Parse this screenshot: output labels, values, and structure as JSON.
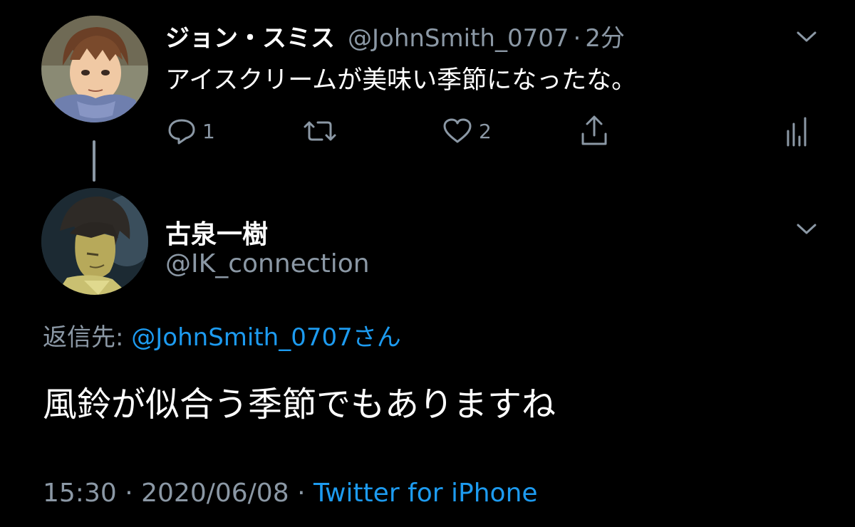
{
  "parent_tweet": {
    "display_name": "ジョン・スミス",
    "handle": "@JohnSmith_0707",
    "separator": "·",
    "time_ago": "2分",
    "text": "アイスクリームが美味い季節になったな。",
    "reply_count": "1",
    "like_count": "2",
    "avatar_icon": "avatar-john-smith"
  },
  "reply_tweet": {
    "display_name": "古泉一樹",
    "handle": "@IK_connection",
    "reply_to_label": "返信先: ",
    "reply_to_mention": "@JohnSmith_0707さん",
    "text": "風鈴が似合う季節でもありますね",
    "time": "15:30",
    "date": "2020/06/08",
    "separator": "·",
    "client": "Twitter for iPhone",
    "avatar_icon": "avatar-koizumi"
  },
  "colors": {
    "background": "#000000",
    "primary_text": "#ffffff",
    "secondary_text": "#8b98a5",
    "link": "#1d9bf0"
  }
}
